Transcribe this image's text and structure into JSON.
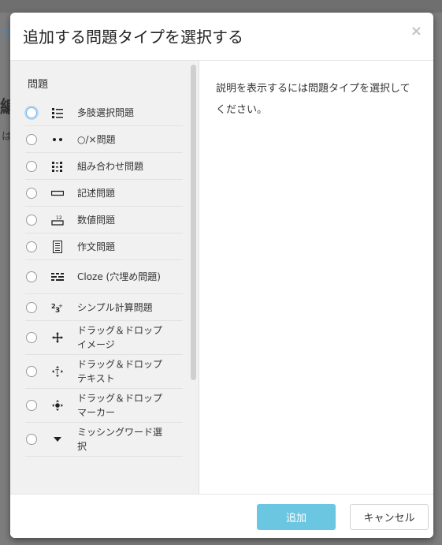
{
  "background": {
    "fragment_link": "ス",
    "fragment_heading": "編",
    "fragment_text": "は"
  },
  "dialog": {
    "title": "追加する問題タイプを選択する",
    "close_symbol": "×"
  },
  "question_list": {
    "heading": "問題",
    "items": [
      {
        "label": "多肢選択問題",
        "icon": "multichoice-icon",
        "selected": false
      },
      {
        "label": "○/×問題",
        "icon": "truefalse-icon",
        "selected": false
      },
      {
        "label": "組み合わせ問題",
        "icon": "match-icon",
        "selected": false
      },
      {
        "label": "記述問題",
        "icon": "shortanswer-icon",
        "selected": false
      },
      {
        "label": "数値問題",
        "icon": "numerical-icon",
        "selected": false
      },
      {
        "label": "作文問題",
        "icon": "essay-icon",
        "selected": false
      },
      {
        "label": "Cloze (穴埋め問題)",
        "icon": "cloze-icon",
        "selected": false
      },
      {
        "label": "シンプル計算問題",
        "icon": "calculatedsimple-icon",
        "selected": false
      },
      {
        "label": "ドラッグ＆ドロップイメージ",
        "icon": "ddimageortext-icon",
        "selected": false
      },
      {
        "label": "ドラッグ＆ドロップテキスト",
        "icon": "ddwtos-icon",
        "selected": false
      },
      {
        "label": "ドラッグ＆ドロップマーカー",
        "icon": "ddmarker-icon",
        "selected": false
      },
      {
        "label": "ミッシングワード選択",
        "icon": "gapselect-icon",
        "selected": false
      }
    ]
  },
  "description": {
    "text": "説明を表示するには問題タイプを選択してください。"
  },
  "footer": {
    "add_label": "追加",
    "cancel_label": "キャンセル"
  },
  "colors": {
    "primary_button": "#5bc0de",
    "list_background": "#f1f1f1"
  }
}
